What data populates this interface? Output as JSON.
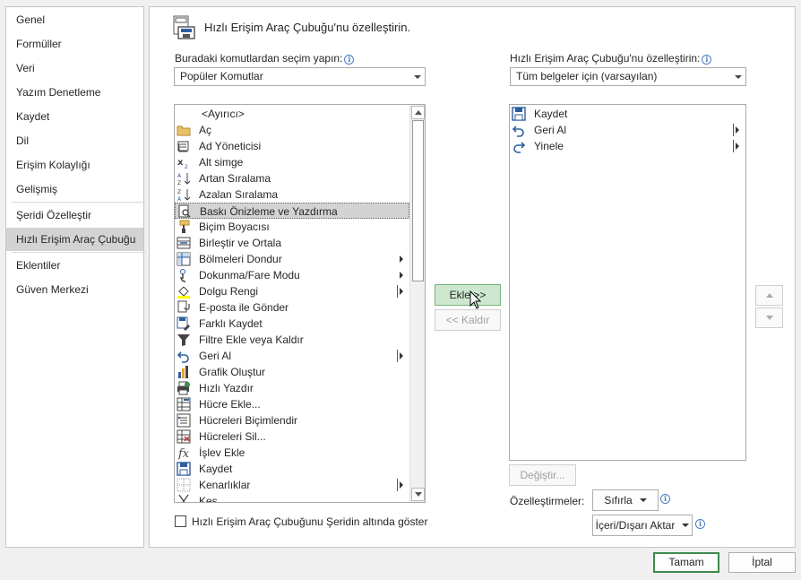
{
  "sidebar": {
    "items": [
      {
        "label": "Genel"
      },
      {
        "label": "Formüller"
      },
      {
        "label": "Veri"
      },
      {
        "label": "Yazım Denetleme"
      },
      {
        "label": "Kaydet"
      },
      {
        "label": "Dil"
      },
      {
        "label": "Erişim Kolaylığı"
      },
      {
        "label": "Gelişmiş"
      },
      {
        "label": "Şeridi Özelleştir"
      },
      {
        "label": "Hızlı Erişim Araç Çubuğu",
        "selected": true
      },
      {
        "label": "Eklentiler"
      },
      {
        "label": "Güven Merkezi"
      }
    ]
  },
  "header": {
    "title": "Hızlı Erişim Araç Çubuğu'nu özelleştirin.",
    "icon": "quick-access-toolbar-icon"
  },
  "left_panel": {
    "label": "Buradaki komutlardan seçim yapın:",
    "combo_value": "Popüler Komutlar",
    "commands": [
      {
        "label": "<Ayırıcı>",
        "icon": "separator"
      },
      {
        "label": "Aç",
        "icon": "folder-icon"
      },
      {
        "label": "Ad Yöneticisi",
        "icon": "name-manager-icon"
      },
      {
        "label": "Alt simge",
        "icon": "subscript-icon"
      },
      {
        "label": "Artan Sıralama",
        "icon": "sort-ascending-icon"
      },
      {
        "label": "Azalan Sıralama",
        "icon": "sort-descending-icon"
      },
      {
        "label": "Baskı Önizleme ve Yazdırma",
        "icon": "print-preview-icon",
        "selected": true
      },
      {
        "label": "Biçim Boyacısı",
        "icon": "format-painter-icon"
      },
      {
        "label": "Birleştir ve Ortala",
        "icon": "merge-center-icon"
      },
      {
        "label": "Bölmeleri Dondur",
        "icon": "freeze-panes-icon",
        "submenu": "arrow"
      },
      {
        "label": "Dokunma/Fare Modu",
        "icon": "touch-mode-icon",
        "submenu": "arrow"
      },
      {
        "label": "Dolgu Rengi",
        "icon": "fill-color-icon",
        "submenu": "split"
      },
      {
        "label": "E-posta ile Gönder",
        "icon": "email-icon"
      },
      {
        "label": "Farklı Kaydet",
        "icon": "save-as-icon"
      },
      {
        "label": "Filtre Ekle veya Kaldır",
        "icon": "filter-icon"
      },
      {
        "label": "Geri Al",
        "icon": "undo-icon",
        "submenu": "split"
      },
      {
        "label": "Grafik Oluştur",
        "icon": "chart-icon"
      },
      {
        "label": "Hızlı Yazdır",
        "icon": "quick-print-icon"
      },
      {
        "label": "Hücre Ekle...",
        "icon": "insert-cells-icon"
      },
      {
        "label": "Hücreleri Biçimlendir",
        "icon": "format-cells-icon"
      },
      {
        "label": "Hücreleri Sil...",
        "icon": "delete-cells-icon"
      },
      {
        "label": "İşlev Ekle",
        "icon": "function-icon"
      },
      {
        "label": "Kaydet",
        "icon": "save-icon"
      },
      {
        "label": "Kenarlıklar",
        "icon": "borders-icon",
        "submenu": "split"
      },
      {
        "label": "Kes",
        "icon": "cut-icon"
      }
    ],
    "checkbox_label": "Hızlı Erişim Araç Çubuğunu Şeridin altında göster"
  },
  "middle": {
    "add_label": "Ekle >>",
    "remove_label": "<< Kaldır"
  },
  "right_panel": {
    "label": "Hızlı Erişim Araç Çubuğu'nu özelleştirin:",
    "combo_value": "Tüm belgeler için (varsayılan)",
    "commands": [
      {
        "label": "Kaydet",
        "icon": "save-icon"
      },
      {
        "label": "Geri Al",
        "icon": "undo-icon",
        "submenu": "split"
      },
      {
        "label": "Yinele",
        "icon": "redo-icon",
        "submenu": "split"
      }
    ],
    "modify_label": "Değiştir...",
    "customizations_label": "Özelleştirmeler:",
    "reset_label": "Sıfırla",
    "import_export_label": "İçeri/Dışarı Aktar"
  },
  "footer": {
    "ok_label": "Tamam",
    "cancel_label": "İptal"
  },
  "colors": {
    "accent_green": "#3d8a4a",
    "selection_gray": "#d3d3d3",
    "icon_blue": "#2e5e9e",
    "info_blue": "#4a7cc1"
  }
}
